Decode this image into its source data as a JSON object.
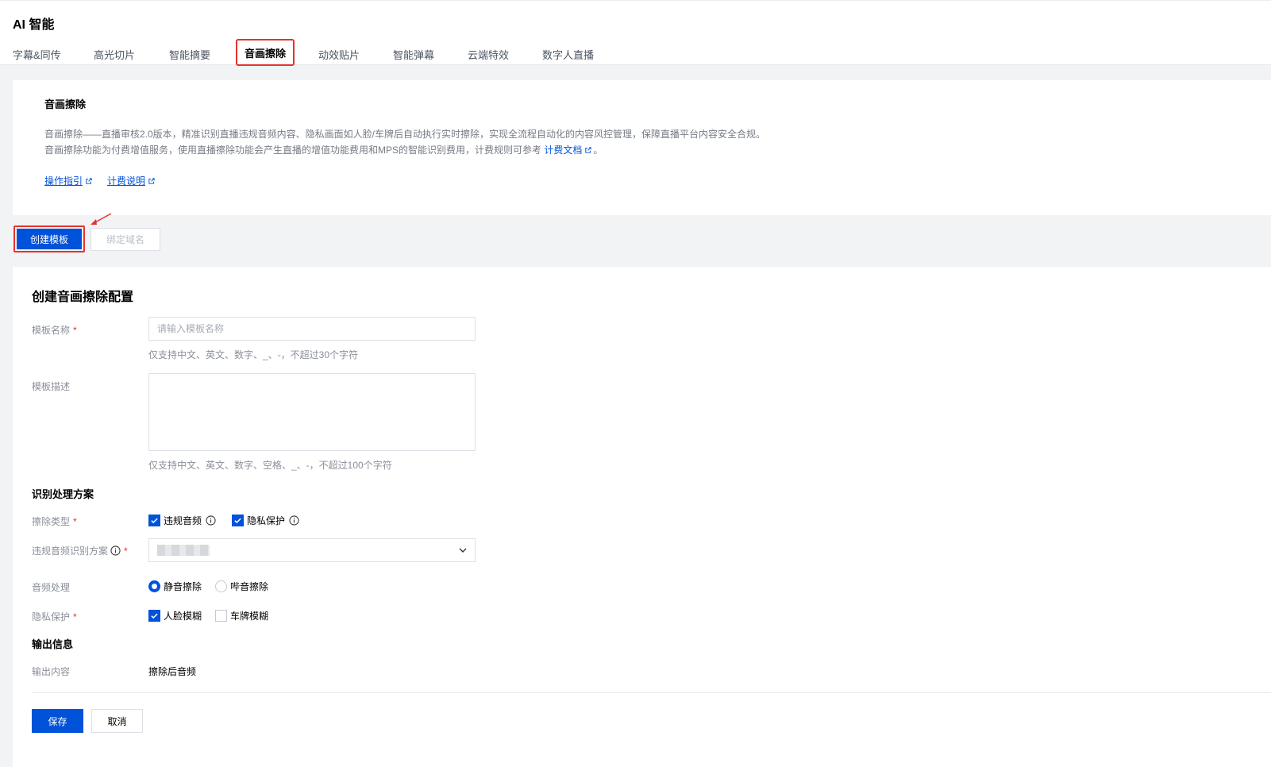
{
  "app": {
    "title": "AI 智能"
  },
  "tabs": [
    {
      "label": "字幕&同传"
    },
    {
      "label": "高光切片"
    },
    {
      "label": "智能摘要"
    },
    {
      "label": "音画擦除"
    },
    {
      "label": "动效贴片"
    },
    {
      "label": "智能弹幕"
    },
    {
      "label": "云端特效"
    },
    {
      "label": "数字人直播"
    }
  ],
  "intro": {
    "title": "音画擦除",
    "line1": "音画擦除——直播审核2.0版本，精准识别直播违规音频内容、隐私画面如人脸/车牌后自动执行实时擦除，实现全流程自动化的内容风控管理，保障直播平台内容安全合规。",
    "line2_prefix": "音画擦除功能为付费增值服务，使用直播擦除功能会产生直播的增值功能费用和MPS的智能识别费用，计费规则可参考",
    "line2_link": "计费文档",
    "line2_suffix": "。",
    "link_guide": "操作指引",
    "link_billing": "计费说明"
  },
  "toolbar": {
    "create_label": "创建模板",
    "bind_label": "绑定域名"
  },
  "form": {
    "title": "创建音画擦除配置",
    "name_label": "模板名称",
    "name_placeholder": "请输入模板名称",
    "name_hint": "仅支持中文、英文、数字、_、-，不超过30个字符",
    "desc_label": "模板描述",
    "desc_hint": "仅支持中文、英文、数字、空格、_、-，不超过100个字符",
    "section_recognition": "识别处理方案",
    "erase_type_label": "擦除类型",
    "erase_type_options": [
      {
        "label": "违规音频",
        "checked": true
      },
      {
        "label": "隐私保护",
        "checked": true
      }
    ],
    "audio_scheme_label": "违规音频识别方案",
    "audio_process_label": "音频处理",
    "audio_process_options": [
      {
        "label": "静音擦除",
        "selected": true
      },
      {
        "label": "哔音擦除",
        "selected": false
      }
    ],
    "privacy_label": "隐私保护",
    "privacy_options": [
      {
        "label": "人脸模糊",
        "checked": true
      },
      {
        "label": "车牌模糊",
        "checked": false
      }
    ],
    "section_output": "输出信息",
    "output_label": "输出内容",
    "output_value": "擦除后音频",
    "required_mark": "*",
    "save_label": "保存",
    "cancel_label": "取消"
  },
  "colors": {
    "primary": "#0052d9",
    "highlight": "#e5322d"
  }
}
